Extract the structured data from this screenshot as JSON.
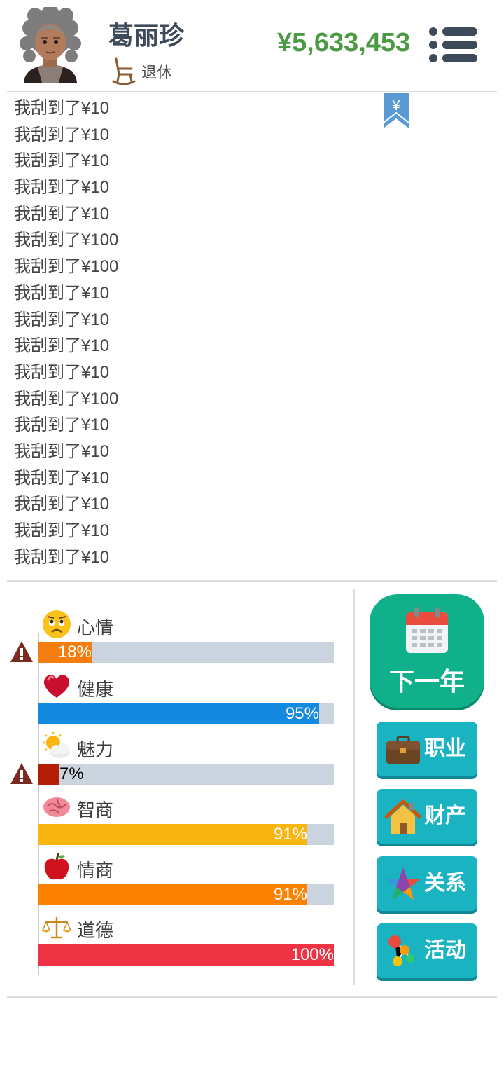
{
  "header": {
    "name": "葛丽珍",
    "status": "退休",
    "money": "¥5,633,453"
  },
  "log": [
    "我刮到了¥10",
    "我刮到了¥10",
    "我刮到了¥10",
    "我刮到了¥10",
    "我刮到了¥10",
    "我刮到了¥100",
    "我刮到了¥100",
    "我刮到了¥10",
    "我刮到了¥10",
    "我刮到了¥10",
    "我刮到了¥10",
    "我刮到了¥100",
    "我刮到了¥10",
    "我刮到了¥10",
    "我刮到了¥10",
    "我刮到了¥10",
    "我刮到了¥10",
    "我刮到了¥10"
  ],
  "bookmark": {
    "symbol": "¥"
  },
  "stats": [
    {
      "key": "mood",
      "label": "心情",
      "value": 18,
      "pct": "18%",
      "color": "#f47d0f",
      "icon": "worried-face-icon",
      "warning": true
    },
    {
      "key": "health",
      "label": "健康",
      "value": 95,
      "pct": "95%",
      "color": "#1389e0",
      "icon": "heart-icon",
      "warning": false
    },
    {
      "key": "charm",
      "label": "魅力",
      "value": 7,
      "pct": "7%",
      "color": "#b51e06",
      "icon": "sun-cloud-icon",
      "warning": true
    },
    {
      "key": "iq",
      "label": "智商",
      "value": 91,
      "pct": "91%",
      "color": "#fbb511",
      "icon": "brain-icon",
      "warning": false
    },
    {
      "key": "eq",
      "label": "情商",
      "value": 91,
      "pct": "91%",
      "color": "#fd8100",
      "icon": "apple-icon",
      "warning": false
    },
    {
      "key": "morality",
      "label": "道德",
      "value": 100,
      "pct": "100%",
      "color": "#ee3344",
      "icon": "scales-icon",
      "warning": false
    }
  ],
  "buttons": {
    "next_year": "下一年",
    "career": "职业",
    "property": "财产",
    "relations": "关系",
    "activities": "活动"
  },
  "colors": {
    "money": "#4d9a45",
    "next_year_bg": "#10b08a",
    "side_button_bg": "#19b3c2",
    "bar_track": "#cad4df"
  }
}
